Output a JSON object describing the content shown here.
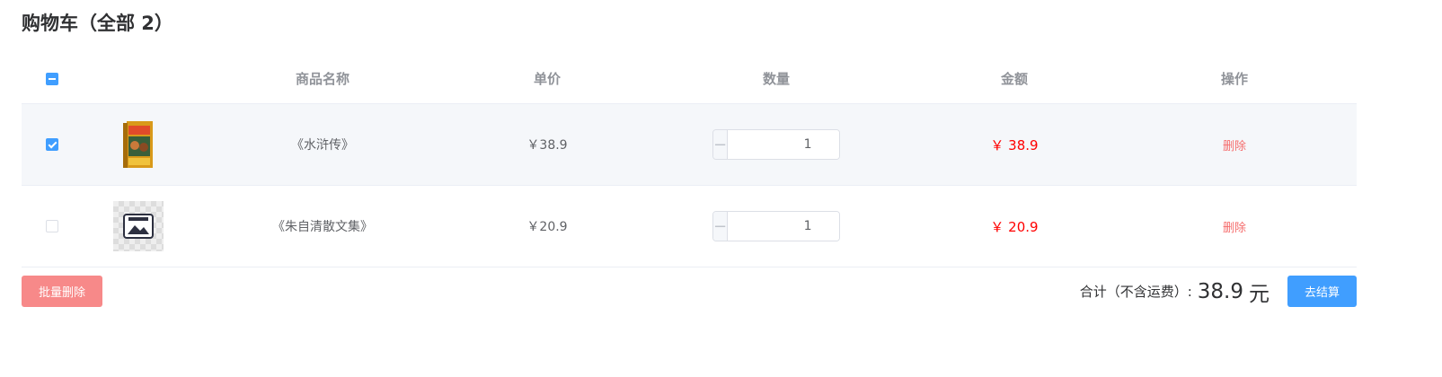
{
  "page_title": "购物车（全部 2）",
  "table": {
    "headers": {
      "name": "商品名称",
      "price": "单价",
      "qty": "数量",
      "amount": "金额",
      "op": "操作"
    },
    "select_all_state": "indeterminate",
    "rows": [
      {
        "checked": true,
        "thumbnail_icon": "book-cover-icon",
        "name": "《水浒传》",
        "price": "￥38.9",
        "qty": "1",
        "amount": "￥ 38.9",
        "delete_label": "删除"
      },
      {
        "checked": false,
        "thumbnail_icon": "image-placeholder-icon",
        "name": "《朱自清散文集》",
        "price": "￥20.9",
        "qty": "1",
        "amount": "￥ 20.9",
        "delete_label": "删除"
      }
    ]
  },
  "stepper": {
    "minus": "−",
    "plus": "+"
  },
  "footer": {
    "batch_delete_label": "批量删除",
    "total_label": "合计（不含运费）:",
    "total_value": "38.9",
    "total_unit": "元",
    "checkout_label": "去结算"
  },
  "colors": {
    "accent": "#409eff",
    "danger": "#f56c6c",
    "price_red": "#ff0000",
    "batch_delete_bg": "#f78989"
  }
}
